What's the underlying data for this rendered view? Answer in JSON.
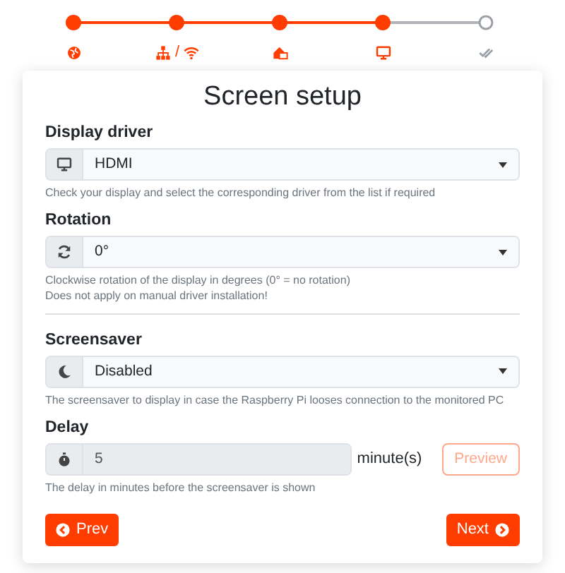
{
  "steps": [
    {
      "done": true
    },
    {
      "done": true,
      "label": "/"
    },
    {
      "done": true
    },
    {
      "done": true
    },
    {
      "done": false
    }
  ],
  "title": "Screen setup",
  "fields": [
    {
      "kind": "select",
      "label": "Display driver",
      "value": "HDMI",
      "disabled": false,
      "help": [
        "Check your display and select the corresponding driver from the list if required"
      ]
    },
    {
      "kind": "select",
      "label": "Rotation",
      "value": "0°",
      "disabled": false,
      "help": [
        "Clockwise rotation of the display in degrees (0° = no rotation)",
        "Does not apply on manual driver installation!"
      ]
    },
    {
      "kind": "divider"
    },
    {
      "kind": "select",
      "label": "Screensaver",
      "value": "Disabled",
      "disabled": false,
      "help": [
        "The screensaver to display in case the Raspberry Pi looses connection to the monitored PC"
      ]
    },
    {
      "kind": "number",
      "label": "Delay",
      "value": "5",
      "disabled": true,
      "unit": "minute(s)",
      "button": {
        "label": "Preview",
        "disabled": true
      },
      "help": [
        "The delay in minutes before the screensaver is shown"
      ]
    }
  ],
  "prev": "Prev",
  "next": "Next"
}
